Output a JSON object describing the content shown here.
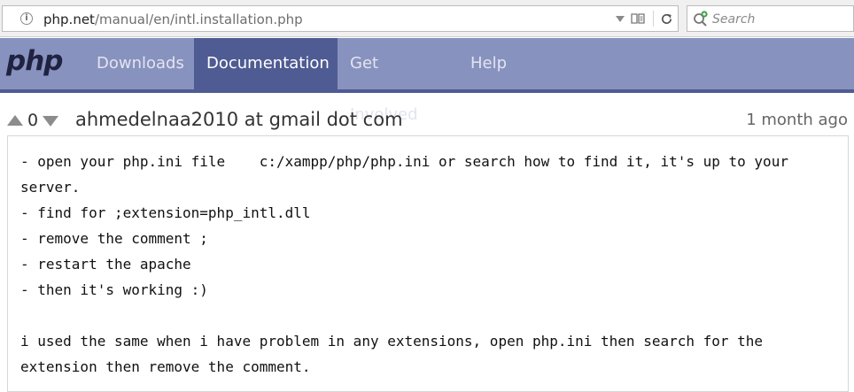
{
  "browser": {
    "url_host": "php.net",
    "url_path": "/manual/en/intl.installation.php",
    "search_placeholder": "Search"
  },
  "nav": {
    "logo": "php",
    "items": [
      "Downloads",
      "Documentation",
      "Get Involved",
      "Help"
    ],
    "active": "Documentation"
  },
  "note": {
    "votes": "0",
    "author": "ahmedelnaa2010 at gmail dot com",
    "date": "1 month ago",
    "body": "- open your php.ini file    c:/xampp/php/php.ini or search how to find it, it's up to your server.\n- find for ;extension=php_intl.dll\n- remove the comment ;\n- restart the apache\n- then it's working :)\n\ni used the same when i have problem in any extensions, open php.ini then search for the extension then remove the comment."
  },
  "colors": {
    "nav_bg": "#8892bf",
    "nav_active": "#4f5b93",
    "logo": "#1f2240"
  },
  "icons": [
    "info-icon",
    "dropdown-arrow-icon",
    "reader-view-icon",
    "reload-icon",
    "search-engine-icon",
    "vote-up-icon",
    "vote-down-icon"
  ]
}
